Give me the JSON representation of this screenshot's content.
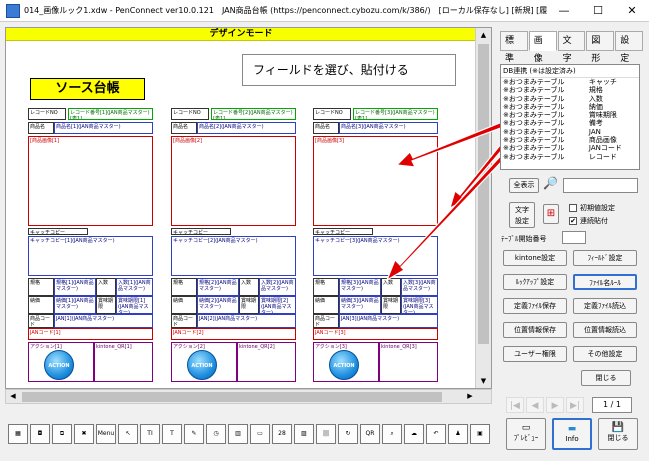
{
  "window": {
    "title": "014_画像ルック1.xdw - PenConnect ver10.0.121　JAN商品台帳 (https://penconnect.cybozu.com/k/386/)　[ローカル保存なし] [新規] [履歴保護]",
    "minimize": "—",
    "maximize": "☐",
    "close": "✕"
  },
  "canvas": {
    "mode_banner": "デザインモード",
    "sheet_title": "ソース台帳",
    "callout": "フィールドを選び、貼付ける",
    "cards": [
      {
        "record_no_label": "レコードNO",
        "record_no_field": "レコード番号[1](JAN商品マスター)[表1]",
        "product_label": "商品名",
        "product_field": "商品名[1](JAN商品マスター)",
        "image_field": "[商品画像[1]",
        "catch_label": "キャッチコピー",
        "catch_field": "キャッチコピー[1](JAN商品マスター)",
        "spec_label": "規格",
        "spec_field": "規格[1](JAN商品マスター)",
        "qty_label": "入数",
        "qty_field": "入数[1](JAN商品マスター)",
        "pack_label": "納価",
        "pack_field": "納価[1](JAN商品マスター)",
        "shelf_label": "賞味期限",
        "shelf_field": "賞味期限[1](JAN商品マスター)",
        "code_label": "商品コード",
        "code_field": "JAN[1](JAN商品マスター)",
        "jan_field": "JANコード[1]",
        "action_field": "アクション[1]",
        "qr_field": "kintone_QR[1]",
        "action_btn": "ACTION"
      },
      {
        "record_no_label": "レコードNO",
        "record_no_field": "レコード番号[2](JAN商品マスター)[表1]",
        "product_label": "商品名",
        "product_field": "商品名[2](JAN商品マスター)",
        "image_field": "[商品画像[2]",
        "catch_label": "キャッチコピー",
        "catch_field": "キャッチコピー[2](JAN商品マスター)",
        "spec_label": "規格",
        "spec_field": "規格[2](JAN商品マスター)",
        "qty_label": "入数",
        "qty_field": "入数[2](JAN商品マスター)",
        "pack_label": "納価",
        "pack_field": "納価[2](JAN商品マスター)",
        "shelf_label": "賞味期限",
        "shelf_field": "賞味期限[2](JAN商品マスター)",
        "code_label": "商品コード",
        "code_field": "JAN[2](JAN商品マスター)",
        "jan_field": "JANコード[2]",
        "action_field": "アクション[2]",
        "qr_field": "kintone_QR[2]",
        "action_btn": "ACTION"
      },
      {
        "record_no_label": "レコードNO",
        "record_no_field": "レコード番号[3](JAN商品マスター)[表1]",
        "product_label": "商品名",
        "product_field": "商品名[3](JAN商品マスター)",
        "image_field": "[商品画像[3]",
        "catch_label": "キャッチコピー",
        "catch_field": "キャッチコピー[3](JAN商品マスター)",
        "spec_label": "規格",
        "spec_field": "規格[3](JAN商品マスター)",
        "qty_label": "入数",
        "qty_field": "入数[3](JAN商品マスター)",
        "pack_label": "納価",
        "pack_field": "納価[3](JAN商品マスター)",
        "shelf_label": "賞味期限",
        "shelf_field": "賞味期限[3](JAN商品マスター)",
        "code_label": "商品コード",
        "code_field": "JAN[3](JAN商品マスター)",
        "jan_field": "JANコード[3]",
        "action_field": "アクション[3]",
        "qr_field": "kintone_QR[3]",
        "action_btn": "ACTION"
      }
    ]
  },
  "panel": {
    "tabs": [
      "標準",
      "画像",
      "文字",
      "図形",
      "設定"
    ],
    "active_tab": "画像",
    "db_header": "DB連携 (※は設定済み)",
    "db_rows": [
      {
        "mark": "※",
        "table": "おつまみテーブル",
        "field": "キャッチ"
      },
      {
        "mark": "※",
        "table": "おつまみテーブル",
        "field": "規格"
      },
      {
        "mark": "※",
        "table": "おつまみテーブル",
        "field": "入数"
      },
      {
        "mark": "※",
        "table": "おつまみテーブル",
        "field": "納価"
      },
      {
        "mark": "※",
        "table": "おつまみテーブル",
        "field": "賞味期限"
      },
      {
        "mark": "※",
        "table": "おつまみテーブル",
        "field": "備考"
      },
      {
        "mark": "※",
        "table": "おつまみテーブル",
        "field": "JAN"
      },
      {
        "mark": "※",
        "table": "おつまみテーブル",
        "field": "商品画像"
      },
      {
        "mark": "※",
        "table": "おつまみテーブル",
        "field": "JANコード"
      },
      {
        "mark": "※",
        "table": "おつまみテーブル",
        "field": "レコード"
      }
    ],
    "show_all": "全表示",
    "search_placeholder": "",
    "text_settings": "文字\n設定",
    "initial_value": "初期値設定",
    "initial_value_checked": false,
    "continuous_paste": "連続貼付",
    "continuous_paste_checked": true,
    "table_start_label": "ﾃｰﾌﾞﾙ開始番号",
    "table_start_value": "",
    "btn_kintone": "kintone設定",
    "btn_field": "ﾌｨｰﾙﾄﾞ設定",
    "btn_lookup": "ﾙｯｸｱｯﾌﾟ設定",
    "btn_file": "ﾌｧｲﾙ名ﾙｰﾙ",
    "btn_def_save": "定義ﾌｧｲﾙ保存",
    "btn_def_load": "定義ﾌｧｲﾙ読込",
    "btn_pos_save": "位置情報保存",
    "btn_pos_load": "位置情報読込",
    "btn_user": "ユーザー権限",
    "btn_other": "その他設定",
    "btn_close_panel": "閉じる",
    "page_indicator": "1 / 1",
    "preview": "ﾌﾟﾚﾋﾞｭｰ",
    "info": "Info",
    "close": "閉じる"
  },
  "toolbar": {
    "icons": [
      "grid-icon",
      "camera-icon",
      "layout-icon",
      "delete-icon",
      "menu-icon",
      "pointer-icon",
      "text-icon",
      "text-edit-icon",
      "pen-icon",
      "clock-icon",
      "columns-icon",
      "image-icon",
      "calendar-icon",
      "photo-icon",
      "barcode-icon",
      "rotate-icon",
      "qr-icon",
      "zoom-icon",
      "shape-icon",
      "undo-icon",
      "stamp-icon",
      "save-icon"
    ],
    "labels": [
      "▦",
      "◘",
      "⧉",
      "✖",
      "Menu",
      "↖",
      "TI",
      "T",
      "✎",
      "◷",
      "▥",
      "▭",
      "28",
      "▨",
      "|||",
      "↻",
      "QR",
      "⌕",
      "☁",
      "↶",
      "♟",
      "▣"
    ]
  }
}
